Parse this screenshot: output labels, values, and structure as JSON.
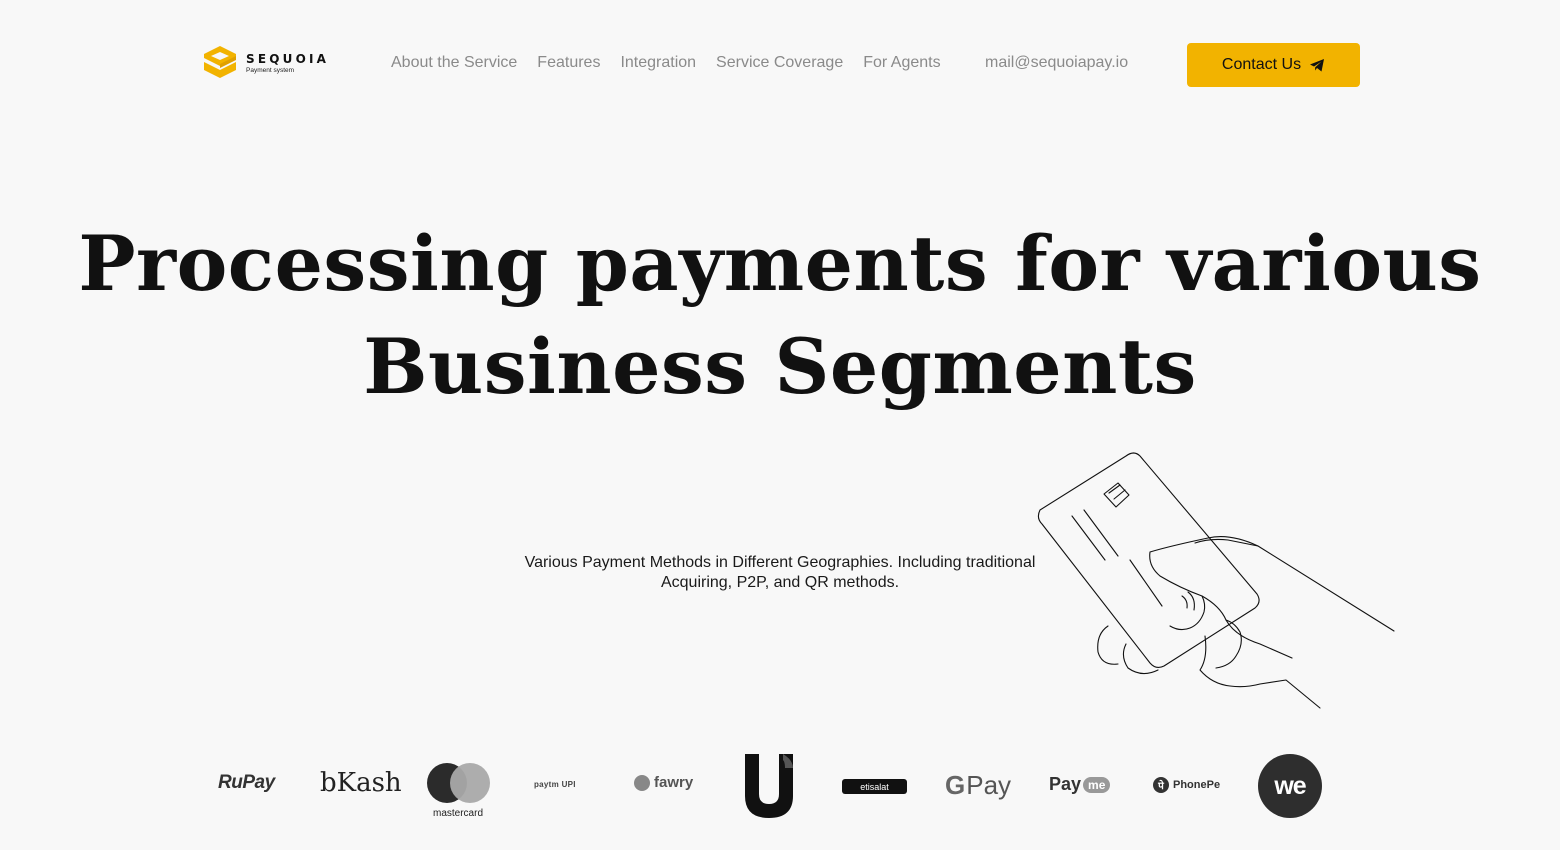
{
  "brand": {
    "name": "SEQUOIA",
    "tagline": "Payment system",
    "accent_color": "#f2b300"
  },
  "nav": {
    "items": [
      {
        "label": "About the Service"
      },
      {
        "label": "Features"
      },
      {
        "label": "Integration"
      },
      {
        "label": "Service Coverage"
      },
      {
        "label": "For Agents"
      }
    ],
    "email": "mail@sequoiapay.io",
    "contact_label": "Contact Us",
    "contact_icon": "telegram-icon"
  },
  "hero": {
    "title": "Processing payments for various Business Segments",
    "subtitle": "Various Payment Methods in Different Geographies. Including traditional Acquiring, P2P, and QR methods.",
    "illustration": "hand-holding-card"
  },
  "payment_logos": {
    "rupay": "RuPay",
    "bkash": "bKash",
    "mastercard": "mastercard",
    "paytm": "paytm UPI",
    "fawry": "fawry",
    "etisalat": "etisalat",
    "gpay_g": "G",
    "gpay": "Pay",
    "payme_pay": "Pay",
    "payme_me": "me",
    "phonepe": "PhonePe",
    "phonepe_mark": "पे",
    "we": "we"
  }
}
